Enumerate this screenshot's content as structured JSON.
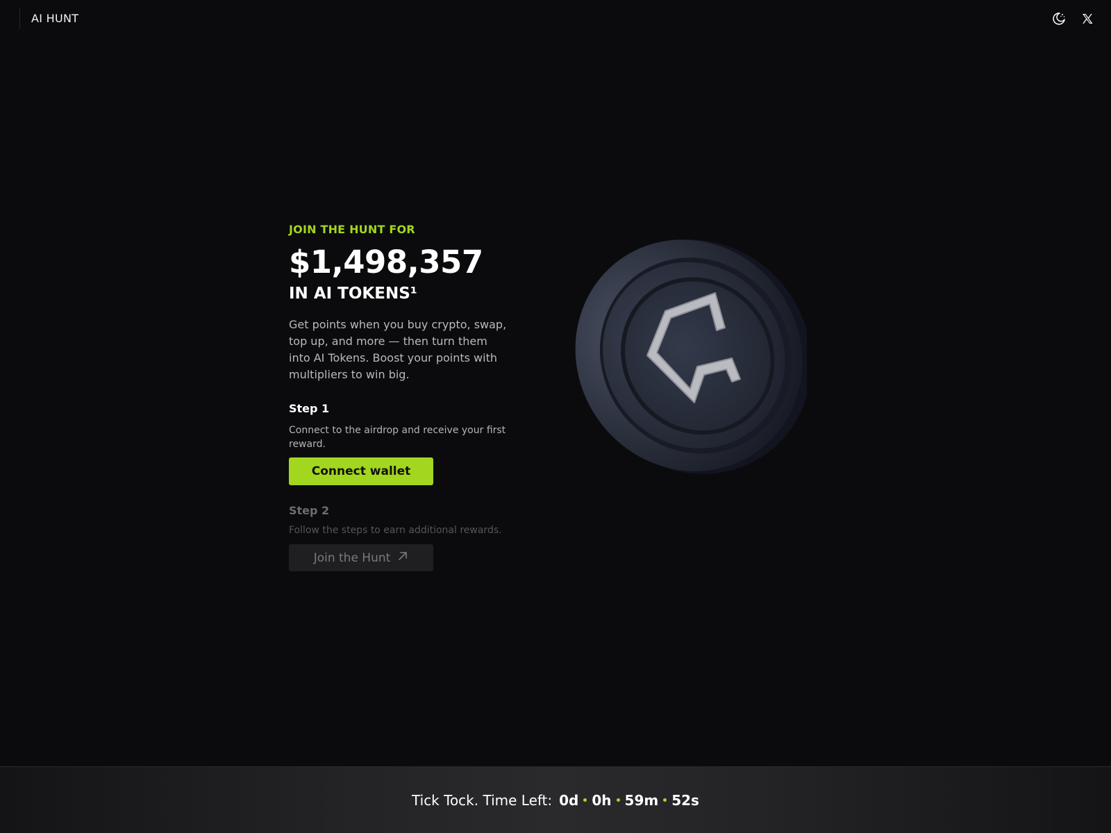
{
  "header": {
    "brand": "AI HUNT",
    "icons": [
      "theme-toggle-icon",
      "x-logo-icon"
    ]
  },
  "hero": {
    "eyebrow": "JOIN THE HUNT FOR",
    "amount": "$1,498,357",
    "token_line": "IN AI TOKENS¹",
    "description": "Get points when you buy crypto, swap, top up, and more — then turn them into AI Tokens. Boost your points with multipliers to win big."
  },
  "step1": {
    "title": "Step 1",
    "text": "Connect to the airdrop and receive your first reward.",
    "button_label": "Connect wallet"
  },
  "step2": {
    "title": "Step 2",
    "text": "Follow the steps to earn additional rewards.",
    "button_label": "Join the Hunt"
  },
  "countdown": {
    "label": "Tick Tock. Time Left:",
    "days": "0d",
    "hours": "0h",
    "minutes": "59m",
    "seconds": "52s"
  },
  "colors": {
    "accent": "#a3d61f",
    "background": "#0b0b0d",
    "coin": "#2a2f3d"
  }
}
